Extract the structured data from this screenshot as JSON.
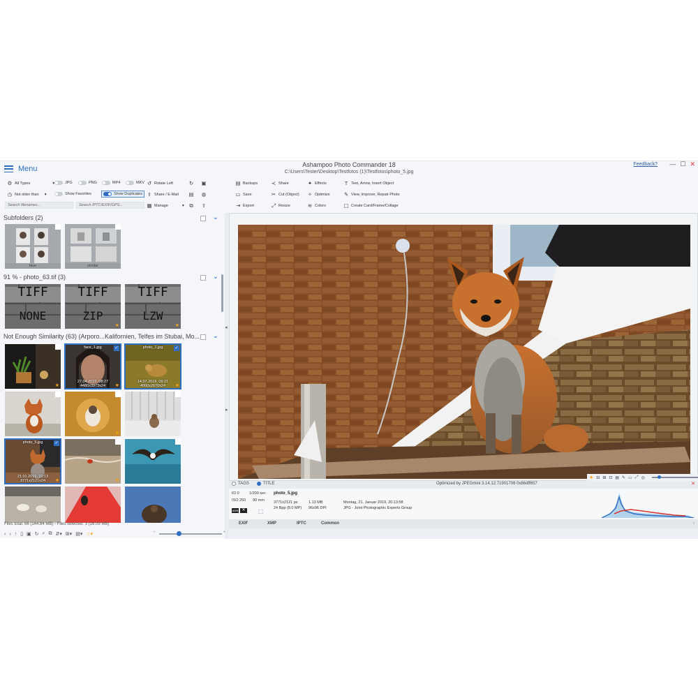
{
  "window": {
    "menu_label": "Menu",
    "title": "Ashampoo Photo Commander 18",
    "path": "C:\\Users\\Tester\\Desktop\\Testfotos (1)\\Testfotos\\photo_5.jpg",
    "feedback": "Feedback?",
    "controls": [
      "—",
      "☐",
      "✕"
    ]
  },
  "toolbar": {
    "all_types": "All Types",
    "not_older_than": "Not older than",
    "filters": {
      "jpg": "JPG",
      "png": "PNG",
      "mp4": "MP4",
      "mkv": "MKV"
    },
    "show_favorites": "Show Favorites",
    "show_duplicates": "Show Duplicates",
    "rotate_left": "Rotate Left",
    "share_email": "Share / E-Mail",
    "manage": "Manage",
    "search_filenames_placeholder": "Search filenames...",
    "search_meta_placeholder": "Search IPTC/EXIF/GPS...",
    "backups": "Backups",
    "save": "Save",
    "export": "Export",
    "share": "Share",
    "cut_object": "Cut (Object)",
    "resize": "Resize",
    "effects": "Effects",
    "optimize": "Optimize",
    "colors": "Colors",
    "text_arrow": "Text, Arrow, Insert Object",
    "view_improve": "View, Improve, Repair Photo",
    "create_card": "Create Card/Frame/Collage"
  },
  "browser": {
    "groups": [
      {
        "title": "Subfolders  (2)"
      },
      {
        "title": "91 % - photo_63.tif  (3)"
      },
      {
        "title": "Not Enough Similarity  (63)  (Arporo...Kalifornien, Telfes im Stubai, Mo..."
      }
    ],
    "subfolders": [
      "blue",
      "similar"
    ],
    "tiff_labels": [
      {
        "top": "TIFF",
        "bottom": "NONE"
      },
      {
        "top": "TIFF",
        "bottom": "ZIP"
      },
      {
        "top": "TIFF",
        "bottom": "LZW"
      }
    ],
    "photos": [
      {
        "name": "",
        "date": "",
        "size": ""
      },
      {
        "name": "face_1.jpg",
        "date": "27.04.2022, 08:27",
        "size": "4480x3973x24"
      },
      {
        "name": "photo_1.jpg",
        "date": "14.07.2019, 09:21",
        "size": "4000x2670x24"
      },
      {
        "name": "photo_5.jpg",
        "date": "21.01.2019, 20:13",
        "size": "3771x2121x24"
      }
    ],
    "status": "Files total: 66 (144.84 MB) - Files selected: 3 (16.09 MB)",
    "zoom_minus": "-",
    "zoom_plus": "+",
    "zoom_level": 0.3
  },
  "info": {
    "tab_tags": "TAGS",
    "tab_title": "TITLE",
    "optimized": "Optimized by JPEGmini 3.14.12.71901706 0x86dff657"
  },
  "metadata": {
    "aperture": "f/2.0",
    "shutter": "1/200 sec",
    "iso": "ISO 250",
    "focal": "90 mm",
    "awb": "AWB",
    "filename": "photo_5.jpg",
    "dimensions": "3771x2121 px",
    "filesize": "1.13 MB",
    "bpp": "24 Bpp (8.0 MP)",
    "dpi": "96x96 DPI",
    "date": "Montag, 21. Januar 2019, 20:13:58",
    "format": "JPG - Joint Photographic Experts Group",
    "tabs": [
      "EXIF",
      "XMP",
      "IPTC",
      "Common"
    ]
  },
  "colors": {
    "accent": "#2f6fc2",
    "favorite": "#f2a41c",
    "close": "#dd3333"
  }
}
